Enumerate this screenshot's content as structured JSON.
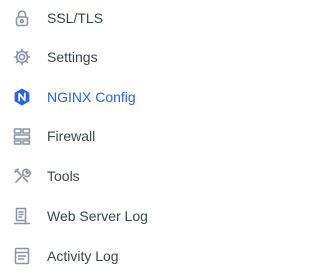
{
  "menu": {
    "active_color": "#2563eb",
    "text_color": "#3a4556",
    "icon_color": "#8a94a6",
    "items": [
      {
        "label": "SSL/TLS",
        "icon": "lock-icon",
        "active": false
      },
      {
        "label": "Settings",
        "icon": "gear-icon",
        "active": false
      },
      {
        "label": "NGINX Config",
        "icon": "nginx-icon",
        "active": true
      },
      {
        "label": "Firewall",
        "icon": "firewall-icon",
        "active": false
      },
      {
        "label": "Tools",
        "icon": "tools-icon",
        "active": false
      },
      {
        "label": "Web Server Log",
        "icon": "web-server-log-icon",
        "active": false
      },
      {
        "label": "Activity Log",
        "icon": "activity-log-icon",
        "active": false
      }
    ]
  }
}
